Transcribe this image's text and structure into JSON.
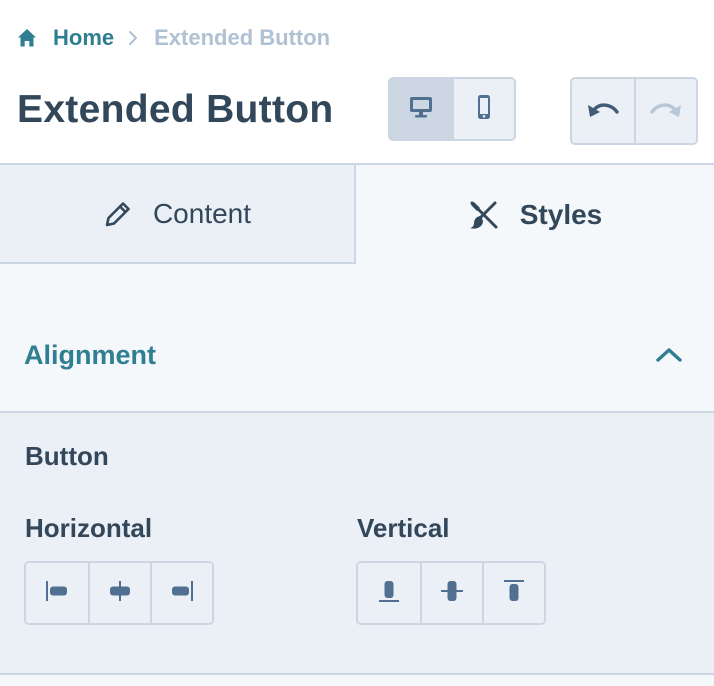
{
  "breadcrumb": {
    "home_label": "Home",
    "current_label": "Extended Button"
  },
  "page_title": "Extended Button",
  "device_toggle": {
    "options": [
      "desktop-icon",
      "mobile-icon"
    ],
    "selected": "desktop"
  },
  "history": {
    "undo_icon": "undo-icon",
    "redo_icon": "redo-icon",
    "redo_enabled": false
  },
  "tabs": [
    {
      "label": "Content",
      "icon": "pencil-icon",
      "active": false
    },
    {
      "label": "Styles",
      "icon": "brush-icon",
      "active": true
    }
  ],
  "accordion": {
    "title": "Alignment",
    "expanded": true
  },
  "alignment": {
    "section_label": "Button",
    "horizontal_label": "Horizontal",
    "vertical_label": "Vertical",
    "horizontal_options": [
      "align-left-icon",
      "align-center-horizontal-icon",
      "align-right-icon"
    ],
    "vertical_options": [
      "align-bottom-icon",
      "align-middle-vertical-icon",
      "align-top-icon"
    ]
  },
  "colors": {
    "accent": "#2f7e91",
    "text": "#33475b",
    "muted": "#b0c1d4",
    "border": "#cbd6e2",
    "panel_bg": "#eaf0f6",
    "light_bg": "#f5f8fa"
  }
}
